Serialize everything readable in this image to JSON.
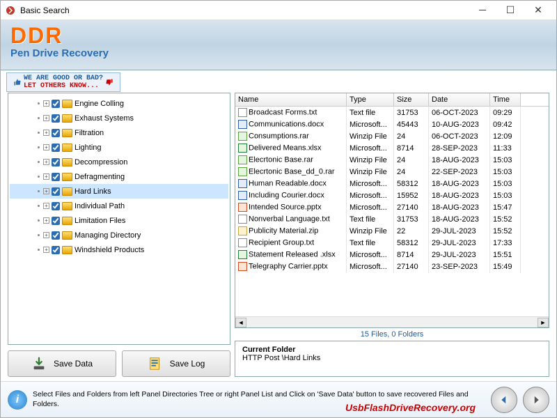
{
  "window": {
    "title": "Basic Search"
  },
  "banner": {
    "logo": "DDR",
    "subtitle": "Pen Drive Recovery"
  },
  "feedback": {
    "line1": "WE ARE GOOD OR BAD?",
    "line2": "LET OTHERS KNOW..."
  },
  "tree": {
    "items": [
      {
        "label": "Engine Colling"
      },
      {
        "label": "Exhaust Systems"
      },
      {
        "label": "Filtration"
      },
      {
        "label": "Lighting"
      },
      {
        "label": "Decompression"
      },
      {
        "label": "Defragmenting"
      },
      {
        "label": "Hard Links",
        "selected": true
      },
      {
        "label": "Individual Path"
      },
      {
        "label": "Limitation Files"
      },
      {
        "label": "Managing Directory"
      },
      {
        "label": "Windshield Products"
      }
    ]
  },
  "buttons": {
    "save_data": "Save Data",
    "save_log": "Save Log"
  },
  "list": {
    "headers": {
      "name": "Name",
      "type": "Type",
      "size": "Size",
      "date": "Date",
      "time": "Time"
    },
    "rows": [
      {
        "icon": "txt",
        "name": "Broadcast Forms.txt",
        "type": "Text file",
        "size": "31753",
        "date": "06-OCT-2023",
        "time": "09:29"
      },
      {
        "icon": "doc",
        "name": "Communications.docx",
        "type": "Microsoft...",
        "size": "45443",
        "date": "10-AUG-2023",
        "time": "09:42"
      },
      {
        "icon": "rar",
        "name": "Consumptions.rar",
        "type": "Winzip File",
        "size": "24",
        "date": "06-OCT-2023",
        "time": "12:09"
      },
      {
        "icon": "xls",
        "name": "Delivered Means.xlsx",
        "type": "Microsoft...",
        "size": "8714",
        "date": "28-SEP-2023",
        "time": "11:33"
      },
      {
        "icon": "rar",
        "name": "Elecrtonic Base.rar",
        "type": "Winzip File",
        "size": "24",
        "date": "18-AUG-2023",
        "time": "15:03"
      },
      {
        "icon": "rar",
        "name": "Elecrtonic Base_dd_0.rar",
        "type": "Winzip File",
        "size": "24",
        "date": "22-SEP-2023",
        "time": "15:03"
      },
      {
        "icon": "doc",
        "name": "Human Readable.docx",
        "type": "Microsoft...",
        "size": "58312",
        "date": "18-AUG-2023",
        "time": "15:03"
      },
      {
        "icon": "doc",
        "name": "Including Courier.docx",
        "type": "Microsoft...",
        "size": "15952",
        "date": "18-AUG-2023",
        "time": "15:03"
      },
      {
        "icon": "ppt",
        "name": "Intended Source.pptx",
        "type": "Microsoft...",
        "size": "27140",
        "date": "18-AUG-2023",
        "time": "15:47"
      },
      {
        "icon": "txt",
        "name": "Nonverbal Language.txt",
        "type": "Text file",
        "size": "31753",
        "date": "18-AUG-2023",
        "time": "15:52"
      },
      {
        "icon": "zip",
        "name": "Publicity Material.zip",
        "type": "Winzip File",
        "size": "22",
        "date": "29-JUL-2023",
        "time": "15:52"
      },
      {
        "icon": "txt",
        "name": "Recipient Group.txt",
        "type": "Text file",
        "size": "58312",
        "date": "29-JUL-2023",
        "time": "17:33"
      },
      {
        "icon": "xls",
        "name": "Statement Released .xlsx",
        "type": "Microsoft...",
        "size": "8714",
        "date": "29-JUL-2023",
        "time": "15:51"
      },
      {
        "icon": "ppt",
        "name": "Telegraphy Carrier.pptx",
        "type": "Microsoft...",
        "size": "27140",
        "date": "23-SEP-2023",
        "time": "15:49"
      }
    ]
  },
  "status": "15 Files, 0 Folders",
  "current": {
    "title": "Current Folder",
    "path": "HTTP Post \\Hard Links"
  },
  "footer": {
    "message": "Select Files and Folders from left Panel Directories Tree or right Panel List and Click on 'Save Data' button to save recovered Files and Folders.",
    "brand": "UsbFlashDriveRecovery.org"
  }
}
